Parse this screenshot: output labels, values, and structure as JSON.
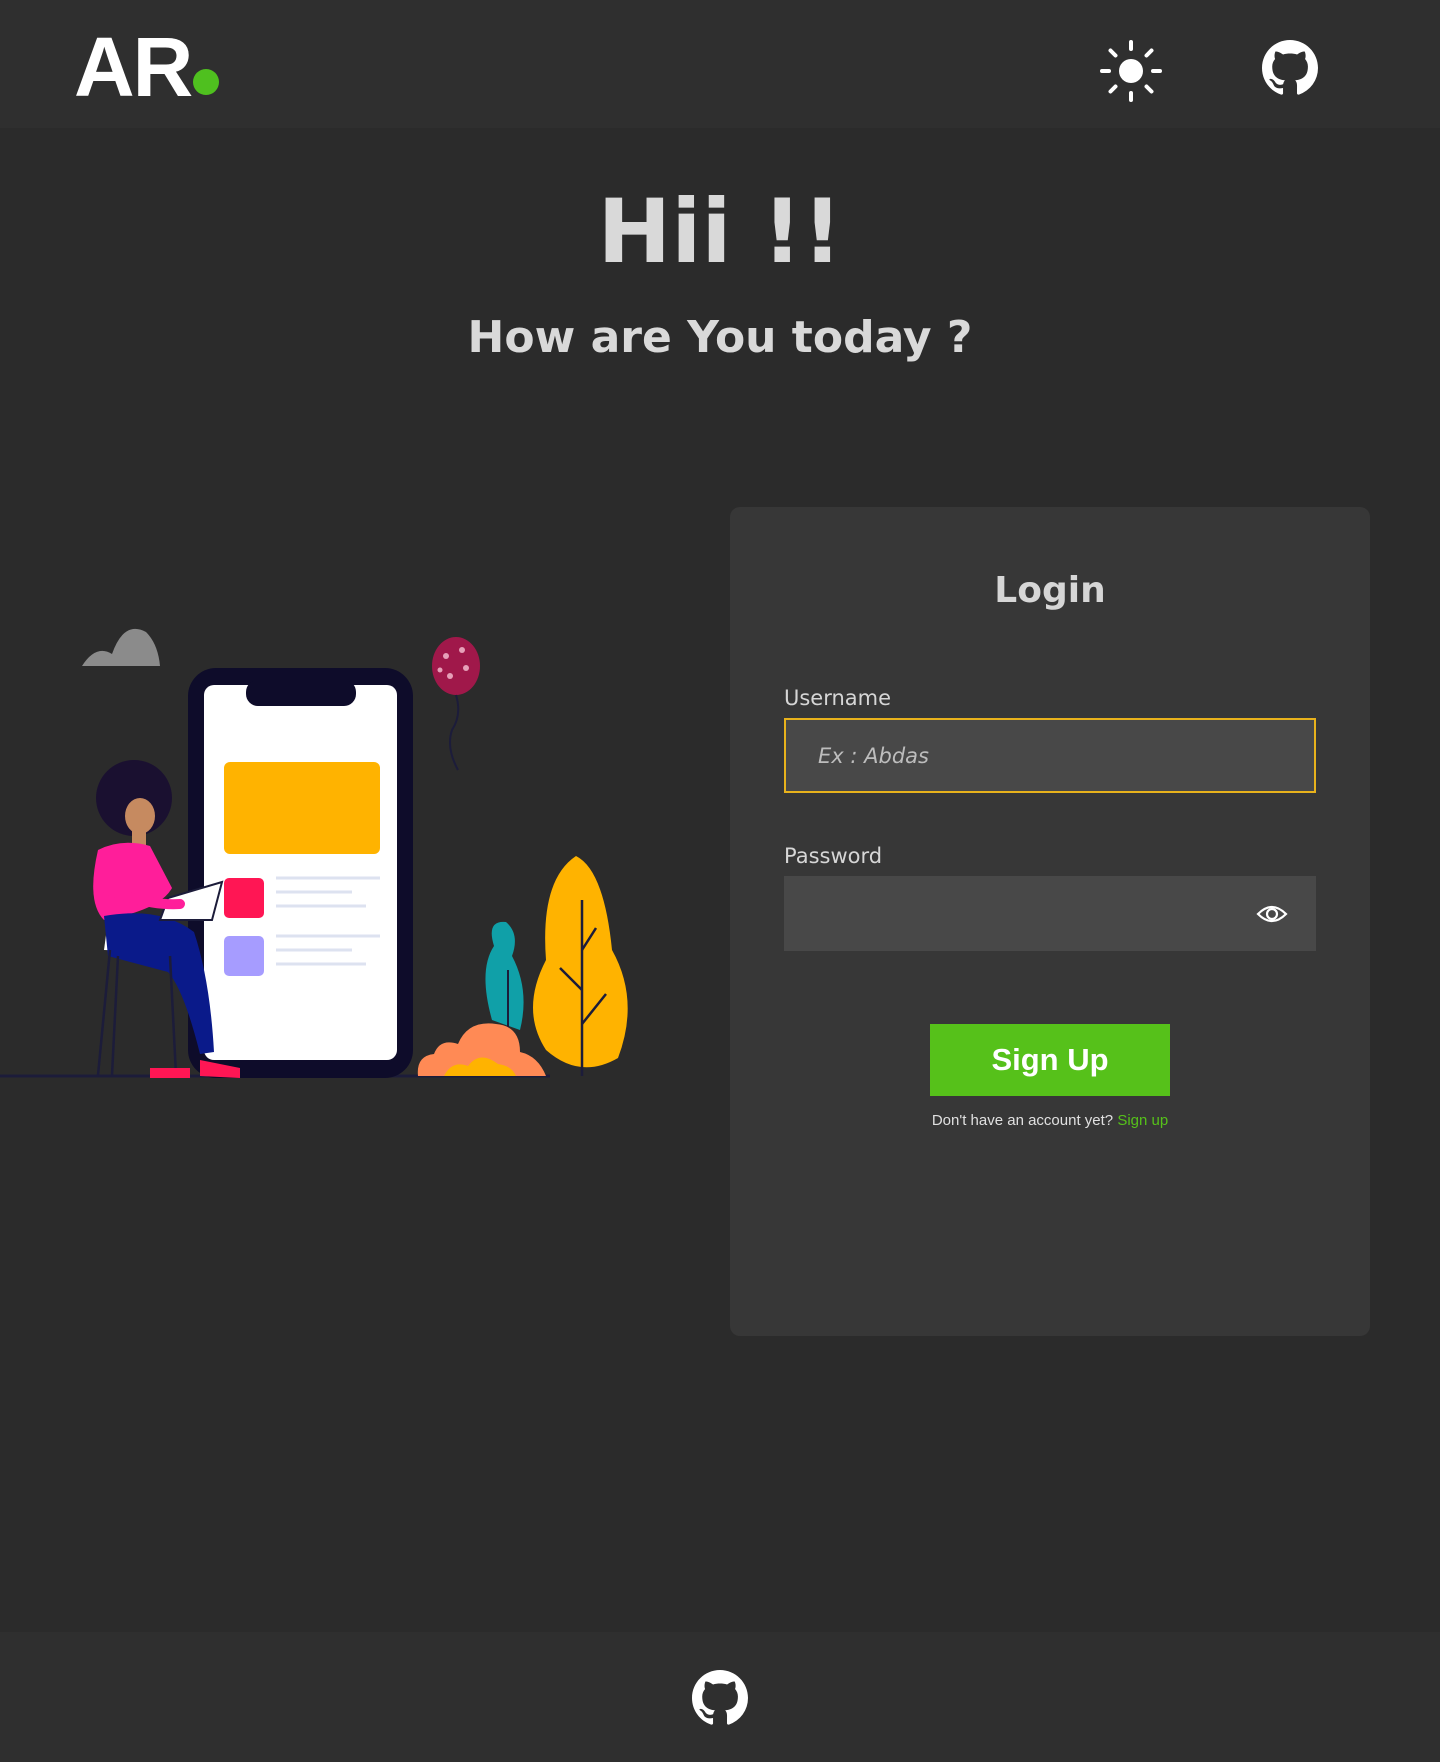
{
  "header": {
    "logo_text": "AR",
    "theme_toggle_icon": "sun-icon",
    "github_icon": "github-icon"
  },
  "greeting": {
    "title": "Hii !!",
    "subtitle": "How are You today ?"
  },
  "login": {
    "title": "Login",
    "username_label": "Username",
    "username_placeholder": "Ex : Abdas",
    "username_value": "",
    "password_label": "Password",
    "password_value": "",
    "show_password_icon": "eye-icon",
    "submit_label": "Sign Up",
    "account_prompt": "Don't have an account yet?",
    "account_link": "Sign up"
  },
  "footer": {
    "github_icon": "github-icon"
  },
  "colors": {
    "background": "#2b2b2b",
    "card": "#373737",
    "accent_green": "#56c11a",
    "focus_border": "#e8b21c"
  }
}
